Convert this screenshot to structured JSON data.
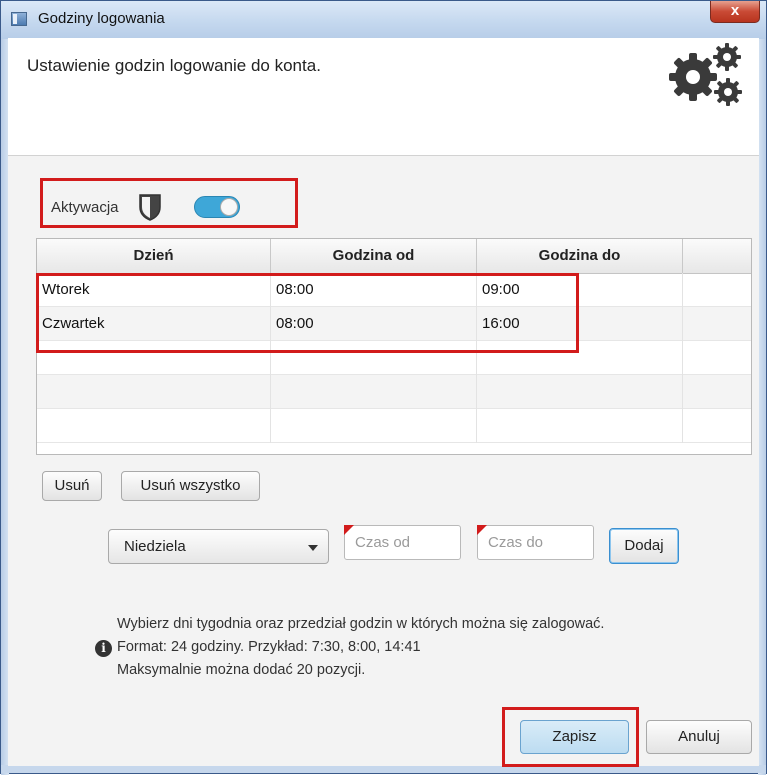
{
  "window": {
    "title": "Godziny logowania",
    "close_symbol": "x"
  },
  "header": {
    "text": "Ustawienie godzin logowanie do konta."
  },
  "activation": {
    "label": "Aktywacja",
    "enabled": true
  },
  "table": {
    "columns": [
      "Dzień",
      "Godzina od",
      "Godzina do",
      ""
    ],
    "rows": [
      {
        "day": "Wtorek",
        "from": "08:00",
        "to": "09:00"
      },
      {
        "day": "Czwartek",
        "from": "08:00",
        "to": "16:00"
      }
    ]
  },
  "actions": {
    "remove": "Usuń",
    "remove_all": "Usuń wszystko"
  },
  "add_form": {
    "day_selected": "Niedziela",
    "time_from_placeholder": "Czas od",
    "time_to_placeholder": "Czas do",
    "add_label": "Dodaj"
  },
  "info": {
    "line1": "Wybierz dni tygodnia oraz przedział godzin w których można się zalogować.",
    "line2": "Format: 24 godziny. Przykład: 7:30, 8:00, 14:41",
    "line3": "Maksymalnie można dodać 20 pozycji.",
    "icon_symbol": "i"
  },
  "footer": {
    "save": "Zapisz",
    "cancel": "Anuluj"
  },
  "colors": {
    "highlight": "#d21b1b",
    "toggle_on": "#3ea7d8"
  }
}
